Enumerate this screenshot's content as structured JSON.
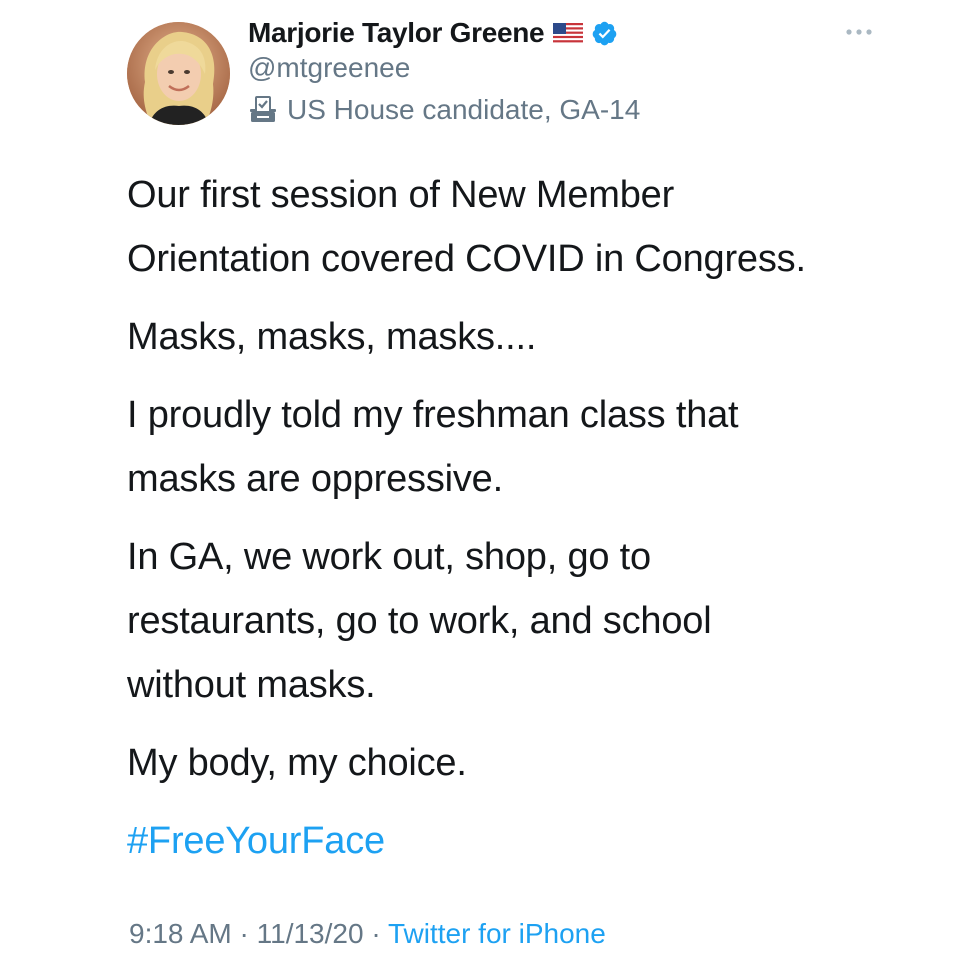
{
  "tweet": {
    "author": {
      "display_name": "Marjorie Taylor Greene",
      "handle": "@mtgreenee",
      "label": "US House candidate, GA-14",
      "badges": [
        "us-flag-icon",
        "verified-icon"
      ]
    },
    "body": {
      "lines": [
        "Our first session of New Member",
        "Orientation covered COVID in Congress.",
        "Masks, masks, masks....",
        "I proudly told my freshman class that",
        "masks are oppressive.",
        "In GA, we work out, shop, go to",
        "restaurants, go to work, and school",
        "without masks.",
        "My body, my choice."
      ],
      "hashtag": "#FreeYourFace"
    },
    "meta": {
      "time": "9:18 AM",
      "separator": "·",
      "date": "11/13/20",
      "source": "Twitter for iPhone"
    }
  },
  "colors": {
    "text": "#14171a",
    "secondary": "#657786",
    "link": "#1da1f2",
    "verified": "#1da1f2"
  }
}
